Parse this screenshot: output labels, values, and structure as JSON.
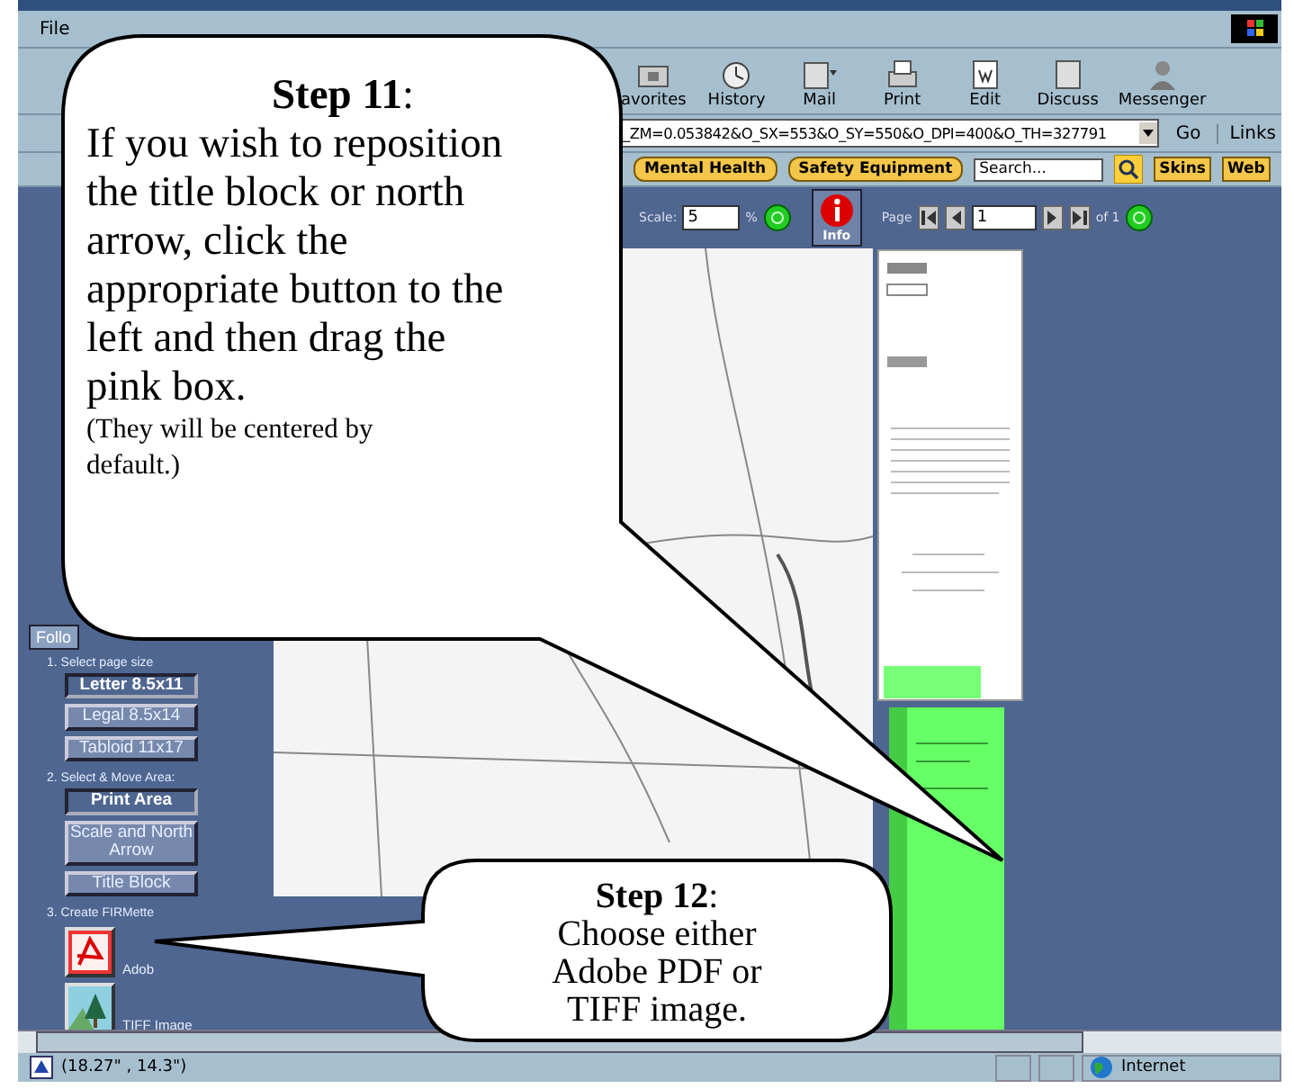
{
  "menu_bar": [
    "File"
  ],
  "toolbar": [
    {
      "kind": "favorites",
      "label": "avorites"
    },
    {
      "kind": "history",
      "label": "History"
    },
    {
      "kind": "mail",
      "label": "Mail"
    },
    {
      "kind": "print",
      "label": "Print"
    },
    {
      "kind": "edit",
      "label": "Edit"
    },
    {
      "kind": "discuss",
      "label": "Discuss"
    },
    {
      "kind": "messenger",
      "label": "Messenger"
    }
  ],
  "address_bar": {
    "value": "_ZM=0.053842&O_SX=553&O_SY=550&O_DPI=400&O_TH=327791",
    "go": "Go",
    "links": "Links"
  },
  "links_bar": {
    "buttons": [
      "Mental Health",
      "Safety Equipment"
    ],
    "search_placeholder": "Search...",
    "tabs": [
      "Skins",
      "Web"
    ]
  },
  "map_toolbar": {
    "scale_label": "Scale:",
    "scale_value": "5",
    "percent": "%",
    "info": "Info",
    "page_label": "Page",
    "page_value": "1",
    "page_of": "of 1"
  },
  "side_panel": {
    "tab": "Follo",
    "sections": [
      {
        "heading": "1. Select page size",
        "buttons": [
          {
            "label": "Letter 8.5x11",
            "selected": true
          },
          {
            "label": "Legal 8.5x14",
            "selected": false
          },
          {
            "label": "Tabloid 11x17",
            "selected": false
          }
        ]
      },
      {
        "heading": "2. Select & Move Area:",
        "buttons": [
          {
            "label": "Print Area",
            "selected": true
          },
          {
            "label": "Scale and North Arrow",
            "selected": false
          },
          {
            "label": "Title Block",
            "selected": false
          }
        ]
      },
      {
        "heading": "3. Create FIRMette",
        "outputs": [
          {
            "kind": "pdf",
            "label": "Adob"
          },
          {
            "kind": "tiff",
            "label": "TIFF Image"
          }
        ]
      }
    ]
  },
  "status_bar": {
    "text": "(18.27\" , 14.3\")",
    "zone": "Internet"
  },
  "callouts": [
    {
      "title": "**Step 11**:",
      "body": "If you wish to reposition the title block or north arrow, click the appropriate button to the left and then drag the pink box.",
      "note": "(They will be centered by default.)"
    },
    {
      "title": "**Step 12**:",
      "body": "Choose either Adobe PDF or TIFF image."
    }
  ]
}
